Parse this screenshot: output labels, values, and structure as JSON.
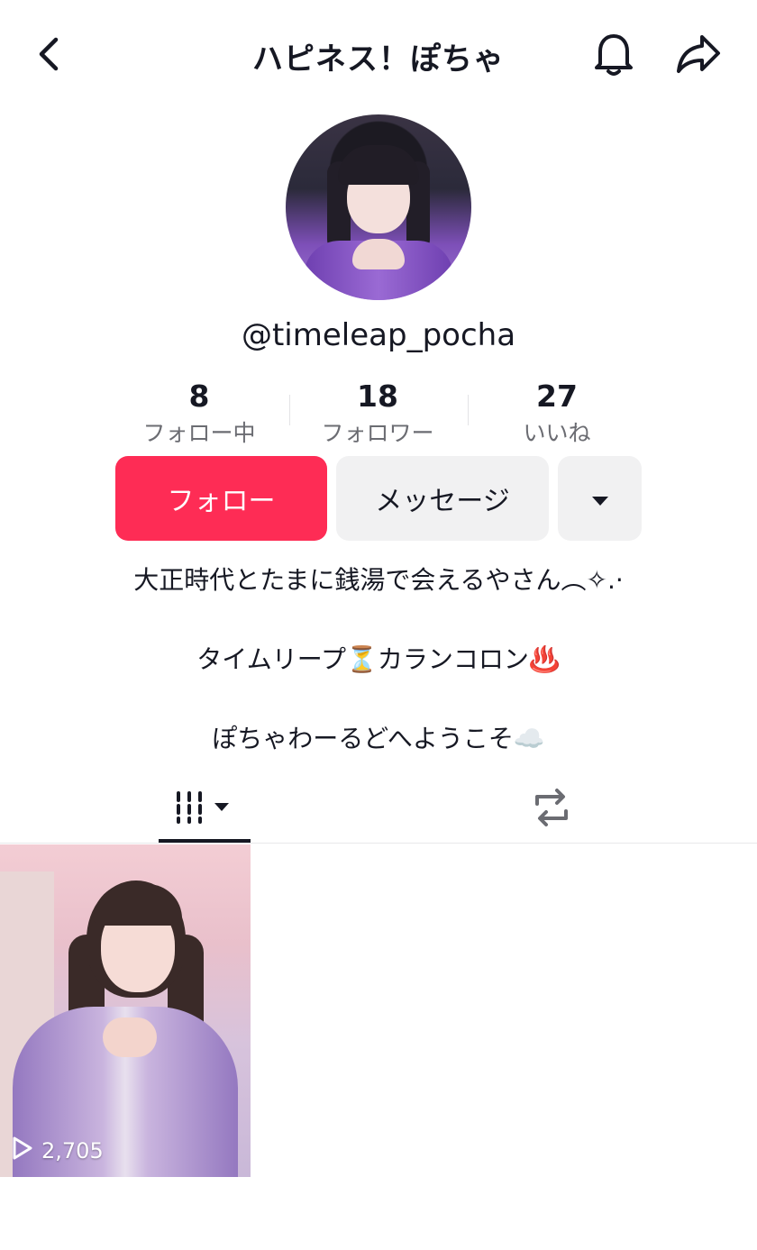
{
  "header": {
    "title": "ハピネス！ぽちゃ"
  },
  "profile": {
    "username": "@timeleap_pocha"
  },
  "stats": [
    {
      "value": "8",
      "label": "フォロー中"
    },
    {
      "value": "18",
      "label": "フォロワー"
    },
    {
      "value": "27",
      "label": "いいね"
    }
  ],
  "actions": {
    "follow_label": "フォロー",
    "message_label": "メッセージ"
  },
  "bio": {
    "line1": "大正時代とたまに銭湯で会えるやさん︵✧.·",
    "line2": "タイムリープ⏳カランコロン♨️",
    "line3": "ぽちゃわーるどへようこそ☁️"
  },
  "videos": [
    {
      "views": "2,705"
    }
  ],
  "colors": {
    "accent": "#fe2c55",
    "secondary_button": "#f1f1f2",
    "text": "#161823",
    "muted_text": "#6b6c72"
  },
  "icons": {
    "back": "chevron-left-icon",
    "bell": "bell-icon",
    "share": "share-arrow-icon",
    "more": "caret-down-icon",
    "videos_tab": "grid-bars-icon",
    "reposts_tab": "repost-icon",
    "play": "play-icon"
  }
}
